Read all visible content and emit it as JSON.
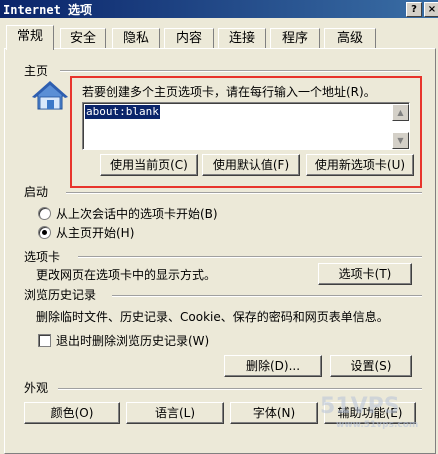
{
  "window": {
    "title": "Internet 选项",
    "help_label": "?",
    "close_label": "×"
  },
  "tabs": [
    {
      "label": "常规",
      "active": true
    },
    {
      "label": "安全"
    },
    {
      "label": "隐私"
    },
    {
      "label": "内容"
    },
    {
      "label": "连接"
    },
    {
      "label": "程序"
    },
    {
      "label": "高级"
    }
  ],
  "homepage": {
    "group_label": "主页",
    "instruction": "若要创建多个主页选项卡，请在每行输入一个地址(R)。",
    "value": "about:blank",
    "buttons": {
      "use_current": "使用当前页(C)",
      "use_default": "使用默认值(F)",
      "use_new_tab": "使用新选项卡(U)"
    }
  },
  "startup": {
    "group_label": "启动",
    "options": [
      {
        "label": "从上次会话中的选项卡开始(B)",
        "checked": false
      },
      {
        "label": "从主页开始(H)",
        "checked": true
      }
    ]
  },
  "tabs_section": {
    "group_label": "选项卡",
    "description": "更改网页在选项卡中的显示方式。",
    "button": "选项卡(T)"
  },
  "history": {
    "group_label": "浏览历史记录",
    "description": "删除临时文件、历史记录、Cookie、保存的密码和网页表单信息。",
    "checkbox_label": "退出时删除浏览历史记录(W)",
    "checkbox_checked": false,
    "delete_button": "删除(D)...",
    "settings_button": "设置(S)"
  },
  "appearance": {
    "group_label": "外观",
    "buttons": {
      "colors": "颜色(O)",
      "languages": "语言(L)",
      "fonts": "字体(N)",
      "accessibility": "辅助功能(E)"
    }
  },
  "watermark": {
    "big": "51VPS",
    "small": "www.51vps.com"
  }
}
